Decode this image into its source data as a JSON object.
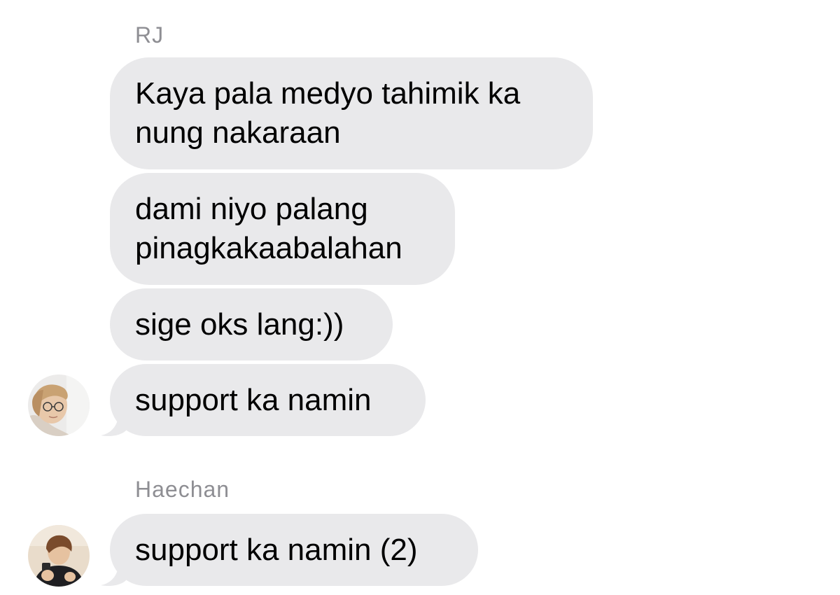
{
  "conversation": {
    "groups": [
      {
        "sender": "RJ",
        "messages": [
          "Kaya pala medyo tahimik ka\nnung nakaraan",
          "dami niyo palang\npinagkakaabalahan",
          "sige oks lang:))",
          "support ka namin"
        ],
        "avatar_icon": "person-with-glasses-avatar"
      },
      {
        "sender": "Haechan",
        "messages": [
          "support ka namin (2)"
        ],
        "avatar_icon": "person-holding-phone-avatar"
      }
    ]
  },
  "colors": {
    "bubble_incoming": "#e9e9eb",
    "sender_name": "#8e8e93",
    "background": "#ffffff",
    "message_text": "#000000"
  }
}
